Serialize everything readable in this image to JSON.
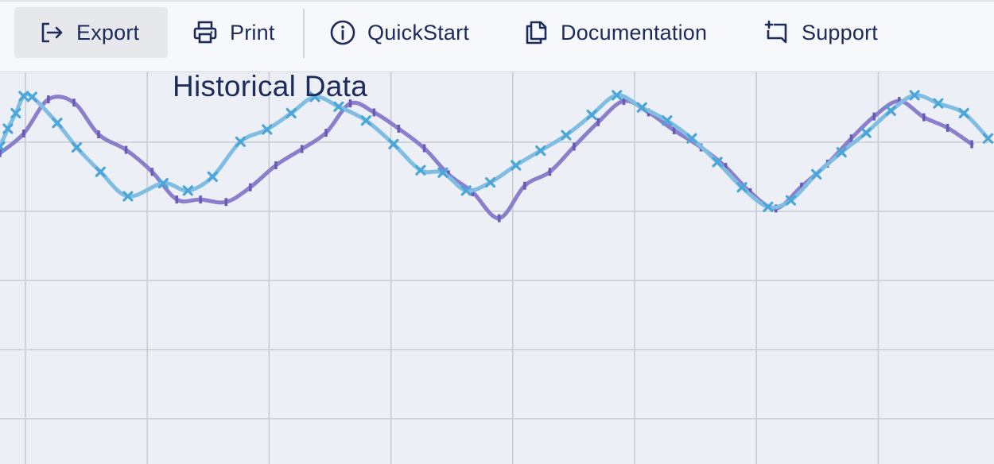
{
  "toolbar": {
    "buttons": [
      {
        "id": "export",
        "label": "Export",
        "icon": "export-icon",
        "active": true
      },
      {
        "id": "print",
        "label": "Print",
        "icon": "printer-icon",
        "active": false
      },
      {
        "id": "quickstart",
        "label": "QuickStart",
        "icon": "info-icon",
        "active": false
      },
      {
        "id": "documentation",
        "label": "Documentation",
        "icon": "documents-icon",
        "active": false
      },
      {
        "id": "support",
        "label": "Support",
        "icon": "support-icon",
        "active": false
      }
    ]
  },
  "colors": {
    "text": "#1c2a5c",
    "plot_background": "#eceff5",
    "grid": "#c9ccd3",
    "series_a": "#7fbde3",
    "series_a_marker": "#4aa6d8",
    "series_b": "#8b7fcc",
    "series_b_marker": "#6a5bb8"
  },
  "chart_data": {
    "type": "line",
    "title": "Historical Data",
    "grid": true,
    "x_gridlines": 9,
    "y_gridlines": 5,
    "series": [
      {
        "marker": "x",
        "points": [
          [
            0,
            42
          ],
          [
            0.17,
            44.2
          ],
          [
            0.34,
            46.1
          ],
          [
            0.51,
            48.2
          ],
          [
            0.69,
            48.1
          ],
          [
            1.23,
            44.9
          ],
          [
            1.65,
            41.9
          ],
          [
            2.16,
            38.9
          ],
          [
            2.75,
            35.9
          ],
          [
            3.51,
            37.5
          ],
          [
            4.04,
            36.6
          ],
          [
            4.57,
            38.3
          ],
          [
            5.17,
            42.6
          ],
          [
            5.74,
            44.1
          ],
          [
            6.26,
            46.1
          ],
          [
            6.77,
            48.1
          ],
          [
            7.28,
            46.9
          ],
          [
            7.87,
            45.2
          ],
          [
            8.46,
            42.3
          ],
          [
            9.04,
            39.1
          ],
          [
            9.52,
            38.8
          ],
          [
            10.02,
            36.6
          ],
          [
            10.54,
            37.6
          ],
          [
            11.09,
            39.7
          ],
          [
            11.62,
            41.5
          ],
          [
            12.17,
            43.4
          ],
          [
            12.72,
            45.9
          ],
          [
            13.26,
            48.3
          ],
          [
            13.8,
            46.8
          ],
          [
            14.34,
            45.2
          ],
          [
            14.87,
            43.0
          ],
          [
            15.42,
            40.1
          ],
          [
            15.95,
            37.0
          ],
          [
            16.51,
            34.6
          ],
          [
            17.0,
            35.4
          ],
          [
            17.55,
            38.6
          ],
          [
            18.09,
            41.3
          ],
          [
            18.62,
            43.7
          ],
          [
            19.15,
            46.4
          ],
          [
            19.66,
            48.3
          ],
          [
            20.17,
            47.3
          ],
          [
            20.72,
            46.1
          ],
          [
            21.24,
            43.0
          ]
        ]
      },
      {
        "marker": "|",
        "points": [
          [
            0,
            41.2
          ],
          [
            0.51,
            43.6
          ],
          [
            1.04,
            47.8
          ],
          [
            1.59,
            47.4
          ],
          [
            2.12,
            43.5
          ],
          [
            2.71,
            41.6
          ],
          [
            3.27,
            38.9
          ],
          [
            3.8,
            35.5
          ],
          [
            4.31,
            35.5
          ],
          [
            4.86,
            35.2
          ],
          [
            5.38,
            37.0
          ],
          [
            5.93,
            39.7
          ],
          [
            6.49,
            41.7
          ],
          [
            7.01,
            43.7
          ],
          [
            7.53,
            47.3
          ],
          [
            8.04,
            46.2
          ],
          [
            8.57,
            44.2
          ],
          [
            9.12,
            41.8
          ],
          [
            9.64,
            38.6
          ],
          [
            10.16,
            36.4
          ],
          [
            10.73,
            33.2
          ],
          [
            11.28,
            37.2
          ],
          [
            11.82,
            38.9
          ],
          [
            12.34,
            42.0
          ],
          [
            12.86,
            45.0
          ],
          [
            13.41,
            47.6
          ],
          [
            13.94,
            46.2
          ],
          [
            14.49,
            44.0
          ],
          [
            15.07,
            41.9
          ],
          [
            15.6,
            39.5
          ],
          [
            16.13,
            36.4
          ],
          [
            16.68,
            34.4
          ],
          [
            17.23,
            37.1
          ],
          [
            17.79,
            39.9
          ],
          [
            18.3,
            43.0
          ],
          [
            18.79,
            45.7
          ],
          [
            19.33,
            47.6
          ],
          [
            19.86,
            45.6
          ],
          [
            20.37,
            44.3
          ],
          [
            20.89,
            42.3
          ]
        ]
      }
    ]
  }
}
